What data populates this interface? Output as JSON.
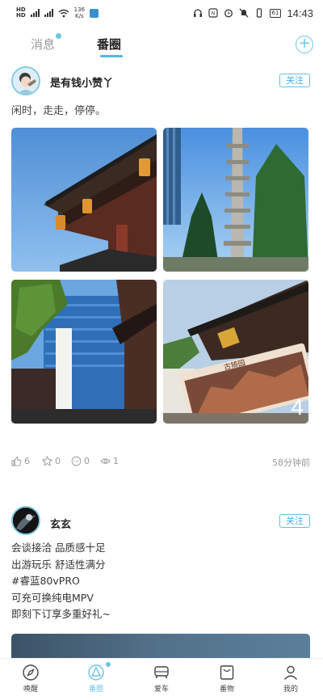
{
  "status_bar": {
    "sim1": "HD",
    "sim2": "HD",
    "net_speed": "136",
    "net_unit": "K/s",
    "battery": "61",
    "time": "14:43"
  },
  "top_tabs": {
    "messages": "消息",
    "fanquan": "番圈"
  },
  "posts": [
    {
      "username": "是有钱小赞丫",
      "follow_label": "关注",
      "text": "闲时，走走，停停。",
      "more_count": "4",
      "likes": "6",
      "stars": "0",
      "comments": "0",
      "views": "1",
      "time": "58分钟前"
    },
    {
      "username": "玄玄",
      "follow_label": "关注",
      "lines": [
        "会谈接洽 品质感十足",
        "出游玩乐 舒适性满分",
        "#睿蓝80vPRO",
        "可充可换纯电MPV",
        "即刻下订享多重好礼~"
      ]
    }
  ],
  "ticket_text": "古猗园",
  "bottom_nav": [
    {
      "label": "唤醒",
      "icon": "compass-icon"
    },
    {
      "label": "番圈",
      "icon": "triangle-circle-icon"
    },
    {
      "label": "爱车",
      "icon": "car-icon"
    },
    {
      "label": "番物",
      "icon": "bag-icon"
    },
    {
      "label": "我的",
      "icon": "person-icon"
    }
  ],
  "colors": {
    "accent": "#6cc5e3",
    "text_muted": "#999999"
  }
}
